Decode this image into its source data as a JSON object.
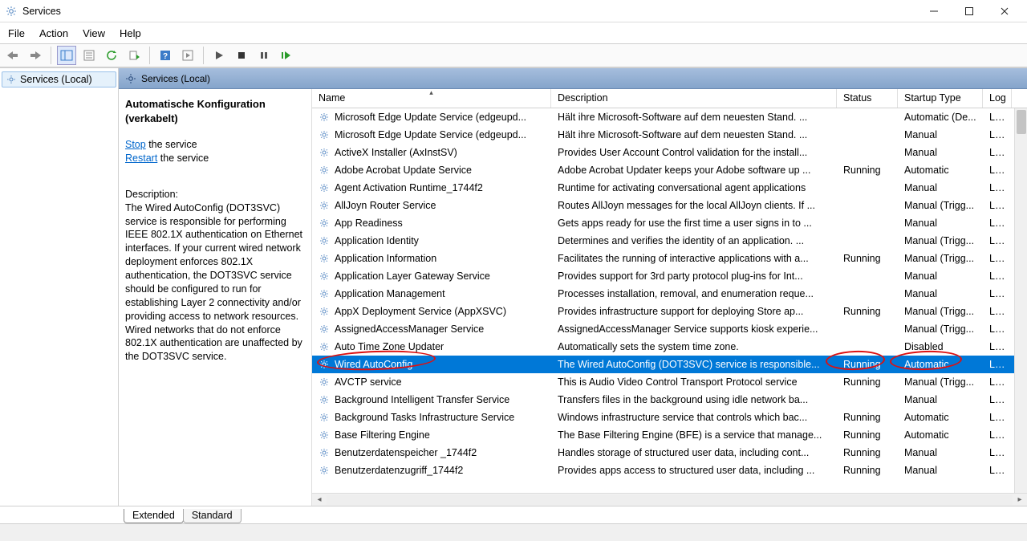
{
  "window": {
    "title": "Services"
  },
  "menu": {
    "file": "File",
    "action": "Action",
    "view": "View",
    "help": "Help"
  },
  "tree": {
    "root": "Services (Local)"
  },
  "panel_header": "Services (Local)",
  "detail": {
    "service_title": "Automatische Konfiguration (verkabelt)",
    "stop_link": "Stop",
    "stop_suffix": " the service",
    "restart_link": "Restart",
    "restart_suffix": " the service",
    "desc_label": "Description:",
    "desc_text": "The Wired AutoConfig (DOT3SVC) service is responsible for performing IEEE 802.1X authentication on Ethernet interfaces. If your current wired network deployment enforces 802.1X authentication, the DOT3SVC service should be configured to run for establishing Layer 2 connectivity and/or providing access to network resources. Wired networks that do not enforce 802.1X authentication are unaffected by the DOT3SVC service."
  },
  "columns": {
    "name": "Name",
    "description": "Description",
    "status": "Status",
    "startup": "Startup Type",
    "logon": "Log"
  },
  "services": [
    {
      "name": "Microsoft Edge Update Service (edgeupd...",
      "desc": "Hält ihre Microsoft-Software auf dem neuesten Stand. ...",
      "status": "",
      "startup": "Automatic (De...",
      "logon": "Loc"
    },
    {
      "name": "Microsoft Edge Update Service (edgeupd...",
      "desc": "Hält ihre Microsoft-Software auf dem neuesten Stand. ...",
      "status": "",
      "startup": "Manual",
      "logon": "Loc"
    },
    {
      "name": "ActiveX Installer (AxInstSV)",
      "desc": "Provides User Account Control validation for the install...",
      "status": "",
      "startup": "Manual",
      "logon": "Loc"
    },
    {
      "name": "Adobe Acrobat Update Service",
      "desc": "Adobe Acrobat Updater keeps your Adobe software up ...",
      "status": "Running",
      "startup": "Automatic",
      "logon": "Loc"
    },
    {
      "name": "Agent Activation Runtime_1744f2",
      "desc": "Runtime for activating conversational agent applications",
      "status": "",
      "startup": "Manual",
      "logon": "Loc"
    },
    {
      "name": "AllJoyn Router Service",
      "desc": "Routes AllJoyn messages for the local AllJoyn clients. If ...",
      "status": "",
      "startup": "Manual (Trigg...",
      "logon": "Loc"
    },
    {
      "name": "App Readiness",
      "desc": "Gets apps ready for use the first time a user signs in to ...",
      "status": "",
      "startup": "Manual",
      "logon": "Loc"
    },
    {
      "name": "Application Identity",
      "desc": "Determines and verifies the identity of an application. ...",
      "status": "",
      "startup": "Manual (Trigg...",
      "logon": "Loc"
    },
    {
      "name": "Application Information",
      "desc": "Facilitates the running of interactive applications with a...",
      "status": "Running",
      "startup": "Manual (Trigg...",
      "logon": "Loc"
    },
    {
      "name": "Application Layer Gateway Service",
      "desc": "Provides support for 3rd party protocol plug-ins for Int...",
      "status": "",
      "startup": "Manual",
      "logon": "Loc"
    },
    {
      "name": "Application Management",
      "desc": "Processes installation, removal, and enumeration reque...",
      "status": "",
      "startup": "Manual",
      "logon": "Loc"
    },
    {
      "name": "AppX Deployment Service (AppXSVC)",
      "desc": "Provides infrastructure support for deploying Store ap...",
      "status": "Running",
      "startup": "Manual (Trigg...",
      "logon": "Loc"
    },
    {
      "name": "AssignedAccessManager Service",
      "desc": "AssignedAccessManager Service supports kiosk experie...",
      "status": "",
      "startup": "Manual (Trigg...",
      "logon": "Loc"
    },
    {
      "name": "Auto Time Zone Updater",
      "desc": "Automatically sets the system time zone.",
      "status": "",
      "startup": "Disabled",
      "logon": "Loc"
    },
    {
      "name": "Wired AutoConfig",
      "desc": "The Wired AutoConfig (DOT3SVC) service is responsible...",
      "status": "Running",
      "startup": "Automatic",
      "logon": "Loc",
      "selected": true
    },
    {
      "name": "AVCTP service",
      "desc": "This is Audio Video Control Transport Protocol service",
      "status": "Running",
      "startup": "Manual (Trigg...",
      "logon": "Loc"
    },
    {
      "name": "Background Intelligent Transfer Service",
      "desc": "Transfers files in the background using idle network ba...",
      "status": "",
      "startup": "Manual",
      "logon": "Loc"
    },
    {
      "name": "Background Tasks Infrastructure Service",
      "desc": "Windows infrastructure service that controls which bac...",
      "status": "Running",
      "startup": "Automatic",
      "logon": "Loc"
    },
    {
      "name": "Base Filtering Engine",
      "desc": "The Base Filtering Engine (BFE) is a service that manage...",
      "status": "Running",
      "startup": "Automatic",
      "logon": "Loc"
    },
    {
      "name": "Benutzerdatenspeicher _1744f2",
      "desc": "Handles storage of structured user data, including cont...",
      "status": "Running",
      "startup": "Manual",
      "logon": "Loc"
    },
    {
      "name": "Benutzerdatenzugriff_1744f2",
      "desc": "Provides apps access to structured user data, including ...",
      "status": "Running",
      "startup": "Manual",
      "logon": "Loc"
    }
  ],
  "tabs": {
    "extended": "Extended",
    "standard": "Standard"
  }
}
